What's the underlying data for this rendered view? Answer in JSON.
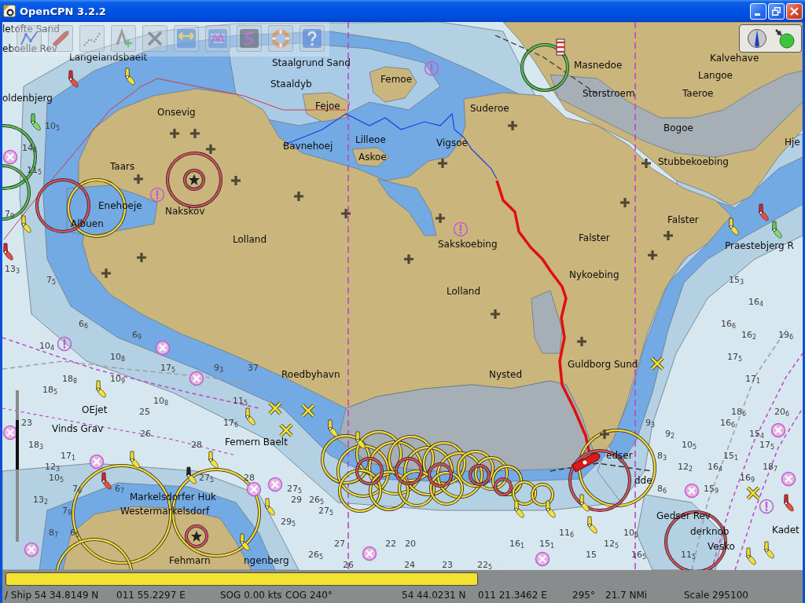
{
  "window": {
    "title": "OpenCPN 3.2.2"
  },
  "chart": {
    "place_names": [
      "letofte Sand",
      "eboelle Rev",
      "Langelandsbaelt",
      "Staalgrund Sand",
      "Masnedoe",
      "Kalvehave",
      "Staaldyb",
      "Femoe",
      "Langoe",
      "oldenbjerg",
      "Storstroem",
      "Taeroe",
      "Onsevig",
      "Fejoe",
      "Suderoe",
      "Bogoe",
      "Bavnehoej",
      "Lilleoe",
      "Vigsoe",
      "Hje",
      "Taars",
      "Askoe",
      "Stubbekoebing",
      "Enehoeje",
      "Nakskov",
      "Albuen",
      "Falster",
      "Lolland",
      "Sakskoebing",
      "Falster",
      "Praestebjerg R",
      "Nykoebing",
      "Lolland",
      "Roedbyhavn",
      "Nysted",
      "Guldborg Sund",
      "OEjet",
      "Vinds Grav",
      "Femern Baelt",
      "edser",
      "dde",
      "Markelsdorfer Huk",
      "Westermarkelsdorf",
      "Gedser Rev",
      "derknob",
      "Kadet",
      "Vesko",
      "Fehmarn",
      "ngenberg"
    ],
    "soundings": [
      "10$_{5}$",
      "14$_{8}$",
      "11$_{5}$",
      "7$_{9}$",
      "13$_{3}$",
      "7$_{5}$",
      "15$_{3}$",
      "16$_{4}$",
      "6$_{6}$",
      "16$_{6}$",
      "6$_{9}$",
      "16$_{2}$",
      "19$_{6}$",
      "10$_{4}$",
      "10$_{8}$",
      "17$_{5}$",
      "17$_{5}$",
      "9$_{3}$",
      "37",
      "18$_{8}$",
      "10$_{9}$",
      "17$_{1}$",
      "18$_{5}$",
      "10$_{8}$",
      "11$_{5}$",
      "25",
      "18$_{6}$",
      "20$_{6}$",
      "23",
      "17$_{6}$",
      "9$_{3}$",
      "16$_{6}$",
      "26",
      "9$_{2}$",
      "15$_{4}$",
      "18$_{3}$",
      "28",
      "10$_{5}$",
      "17$_{5}$",
      "17$_{1}$",
      "8$_{3}$",
      "15$_{1}$",
      "12$_{3}$",
      "12$_{2}$",
      "16$_{4}$",
      "18$_{7}$",
      "10$_{5}$",
      "27$_{5}$",
      "28",
      "16$_{9}$",
      "7$_{6}$",
      "6$_{7}$",
      "27$_{5}$",
      "8$_{6}$",
      "15$_{9}$",
      "13$_{2}$",
      "29",
      "26$_{5}$",
      "7$_{9}$",
      "27$_{5}$",
      "29$_{5}$",
      "8$_{7}$",
      "6$_{5}$",
      "11$_{6}$",
      "10$_{5}$",
      "27",
      "22",
      "20",
      "16$_{1}$",
      "15$_{1}$",
      "12$_{5}$",
      "26$_{5}$",
      "15",
      "16$_{5}$",
      "11$_{5}$",
      "26",
      "24",
      "23",
      "22$_{5}$"
    ]
  },
  "chart_bar": {
    "keys": [
      {
        "selected": true
      }
    ]
  },
  "status_bar": {
    "fields": [
      "/ Ship 54 34.8149 N",
      "011 55.2297 E",
      "SOG 0.00 kts",
      "COG 240°",
      "54 44.0231 N",
      "011 21.3462 E",
      "295°",
      "21.7 NMi",
      "Scale 295100"
    ]
  }
}
